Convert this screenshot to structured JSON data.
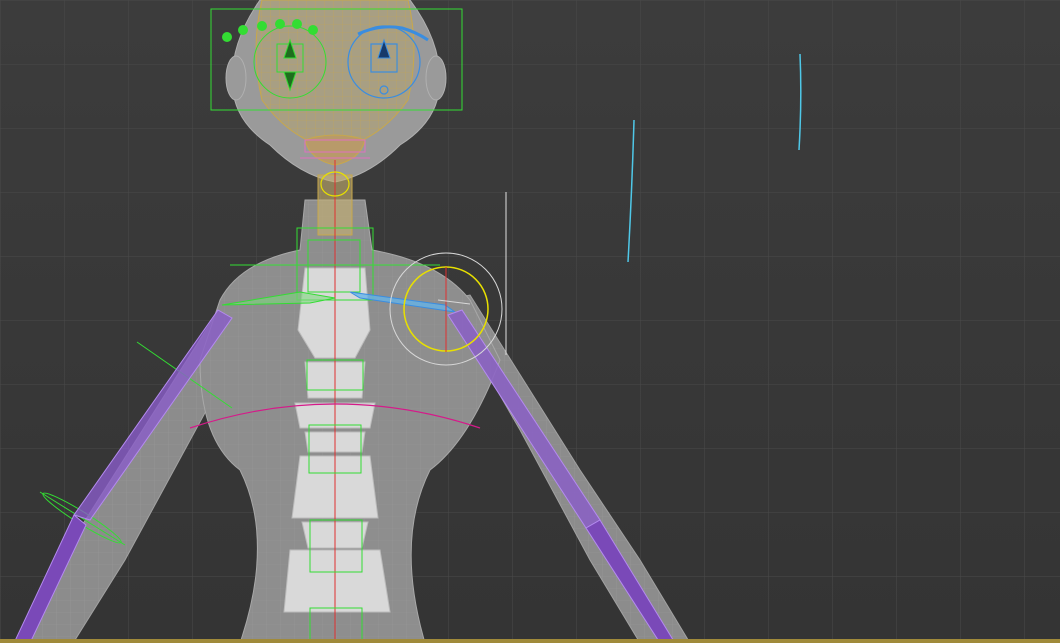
{
  "viewport": {
    "label": "",
    "background": "#3a3a3a",
    "grid_color": "#4a4a4a",
    "colors": {
      "body_fill": "#8c8c8c",
      "body_wire": "#a2a2a2",
      "spine_fill": "#d9d9d9",
      "face_wire": "#c8a84a",
      "rig_green": "#33dd33",
      "rig_blue": "#3a8de0",
      "arm_bone": "#8a5cc9",
      "selection_yellow": "#e8e000",
      "selection_white": "#d8d8d8",
      "arc_magenta": "#d51a8a",
      "cyan_line": "#4fc8e8",
      "ground_line": "#a08a3a"
    }
  }
}
